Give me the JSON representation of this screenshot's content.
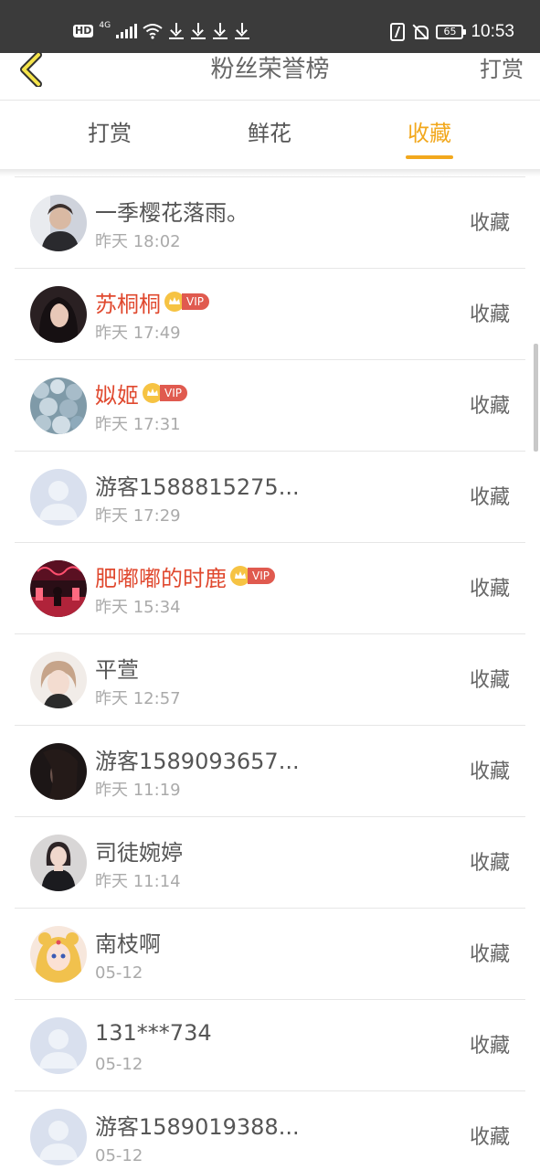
{
  "status_bar": {
    "left_badge": "HD",
    "network": "4G",
    "battery": "65",
    "time": "10:53",
    "icons": [
      "hd-icon",
      "signal-icon",
      "wifi-icon",
      "download-icon",
      "download-icon",
      "download-icon",
      "download-icon",
      "nfc-icon",
      "bell-off-icon",
      "battery-icon"
    ]
  },
  "header": {
    "title": "粉丝荣誉榜",
    "right_button": "打赏",
    "back_icon": "chevron-left-icon"
  },
  "tabs": [
    {
      "label": "打赏",
      "active": false
    },
    {
      "label": "鲜花",
      "active": false
    },
    {
      "label": "收藏",
      "active": true
    }
  ],
  "colors": {
    "accent": "#f2a81d",
    "vip_name": "#e0492f",
    "vip_badge": "#e05a4f",
    "status_bar": "#3b3b3b"
  },
  "vip_label": "VIP",
  "list": [
    {
      "name": "一季樱花落雨。",
      "time": "昨天 18:02",
      "action": "收藏",
      "vip": false,
      "avatar": "photo"
    },
    {
      "name": "苏桐桐",
      "time": "昨天 17:49",
      "action": "收藏",
      "vip": true,
      "avatar": "photo"
    },
    {
      "name": "姒姬",
      "time": "昨天 17:31",
      "action": "收藏",
      "vip": true,
      "avatar": "photo"
    },
    {
      "name": "游客1588815275...",
      "time": "昨天 17:29",
      "action": "收藏",
      "vip": false,
      "avatar": "default"
    },
    {
      "name": "肥嘟嘟的时鹿",
      "time": "昨天 15:34",
      "action": "收藏",
      "vip": true,
      "avatar": "photo"
    },
    {
      "name": "平萱",
      "time": "昨天 12:57",
      "action": "收藏",
      "vip": false,
      "avatar": "photo"
    },
    {
      "name": "游客1589093657...",
      "time": "昨天 11:19",
      "action": "收藏",
      "vip": false,
      "avatar": "photo"
    },
    {
      "name": "司徒婉婷",
      "time": "昨天 11:14",
      "action": "收藏",
      "vip": false,
      "avatar": "photo"
    },
    {
      "name": "南枝啊",
      "time": "05-12",
      "action": "收藏",
      "vip": false,
      "avatar": "photo"
    },
    {
      "name": "131***734",
      "time": "05-12",
      "action": "收藏",
      "vip": false,
      "avatar": "default"
    },
    {
      "name": "游客1589019388...",
      "time": "05-12",
      "action": "收藏",
      "vip": false,
      "avatar": "default"
    }
  ]
}
